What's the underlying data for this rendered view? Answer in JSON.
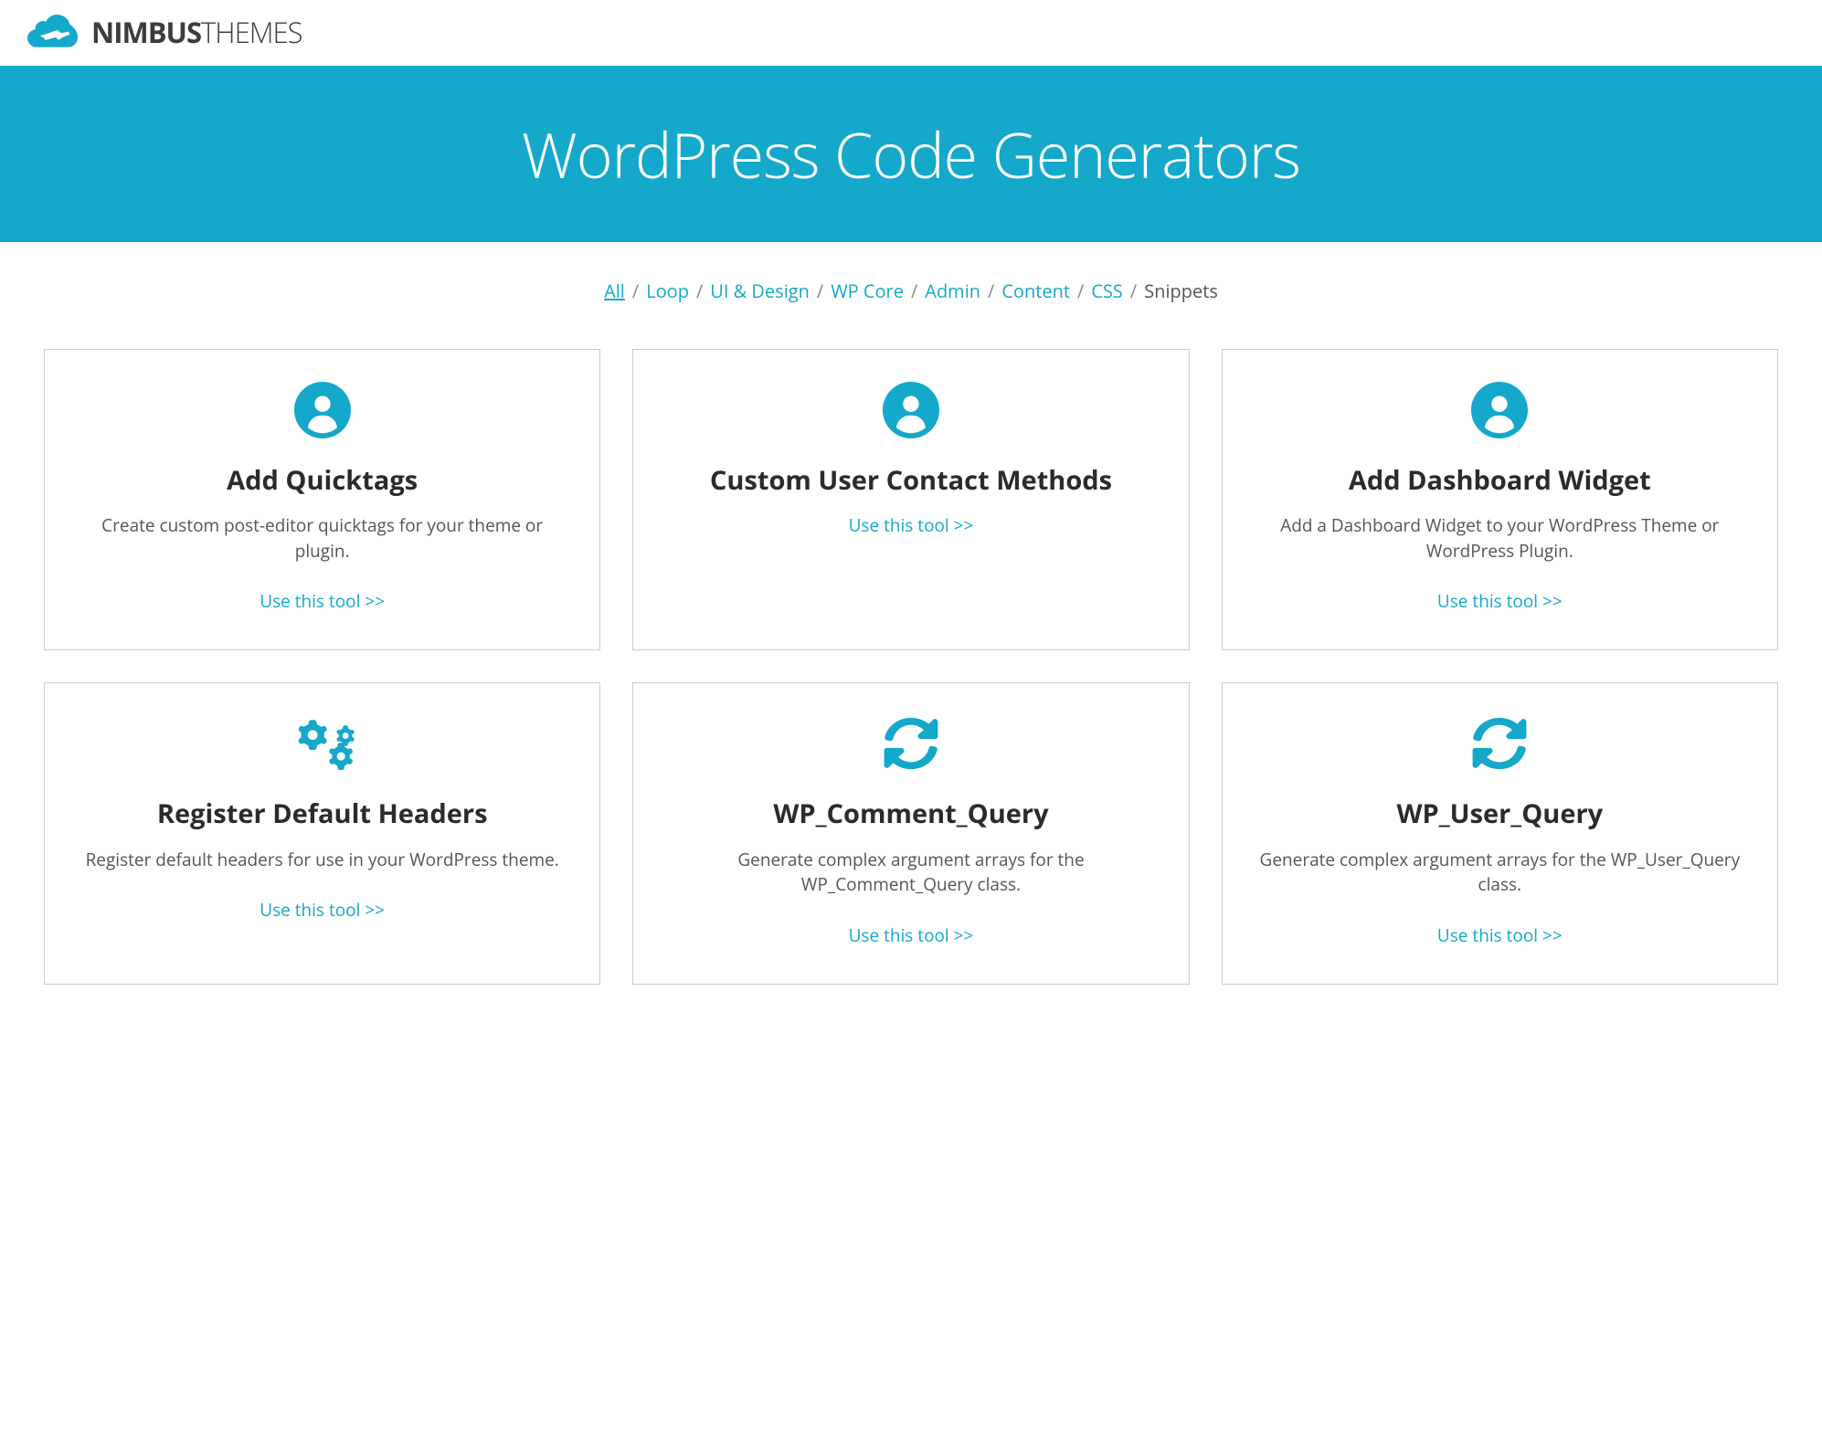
{
  "brand": {
    "name_bold": "NIMBUS",
    "name_light": "THEMES"
  },
  "hero": {
    "title": "WordPress Code Generators"
  },
  "filters": [
    {
      "label": "All",
      "active": true
    },
    {
      "label": "Loop",
      "active": false
    },
    {
      "label": "UI & Design",
      "active": false
    },
    {
      "label": "WP Core",
      "active": false
    },
    {
      "label": "Admin",
      "active": false
    },
    {
      "label": "Content",
      "active": false
    },
    {
      "label": "CSS",
      "active": false
    },
    {
      "label": "Snippets",
      "active": false
    }
  ],
  "link_text": "Use this tool >>",
  "cards": [
    {
      "icon": "user",
      "title": "Add Quicktags",
      "desc": "Create custom post-editor quicktags for your theme or plugin."
    },
    {
      "icon": "user",
      "title": "Custom User Contact Methods",
      "desc": ""
    },
    {
      "icon": "user",
      "title": "Add Dashboard Widget",
      "desc": "Add a Dashboard Widget to your WordPress Theme or WordPress Plugin."
    },
    {
      "icon": "gears",
      "title": "Register Default Headers",
      "desc": "Register default headers for use in your WordPress theme."
    },
    {
      "icon": "refresh",
      "title": "WP_Comment_Query",
      "desc": "Generate complex argument arrays for the WP_Comment_Query class."
    },
    {
      "icon": "refresh",
      "title": "WP_User_Query",
      "desc": "Generate complex argument arrays for the WP_User_Query class."
    }
  ]
}
